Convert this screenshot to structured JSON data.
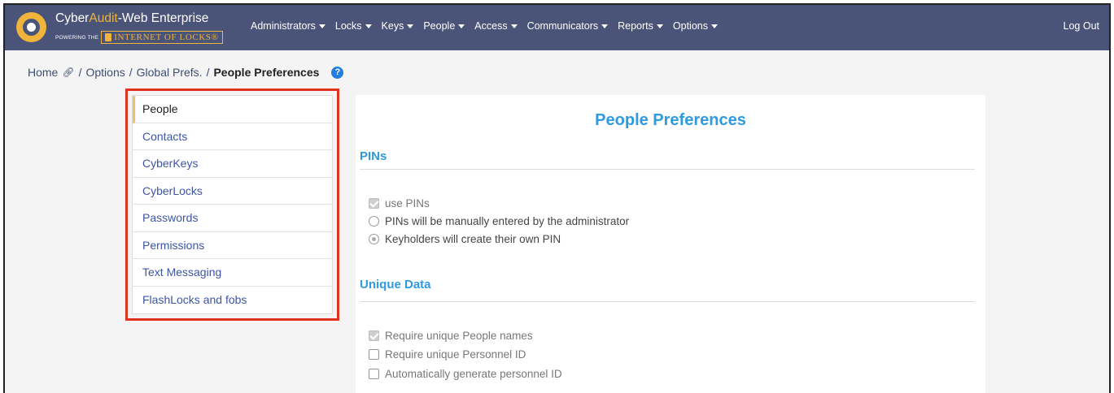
{
  "brand": {
    "name_part1": "Cyber",
    "name_part2": "Audit",
    "name_part3": "-Web Enterprise",
    "tagline_small": "POWERING THE",
    "tagline_big": "INTERNET OF LOCKS®"
  },
  "nav": {
    "items": [
      {
        "label": "Administrators"
      },
      {
        "label": "Locks"
      },
      {
        "label": "Keys"
      },
      {
        "label": "People"
      },
      {
        "label": "Access"
      },
      {
        "label": "Communicators"
      },
      {
        "label": "Reports"
      },
      {
        "label": "Options"
      }
    ],
    "logout": "Log Out"
  },
  "breadcrumb": {
    "home": "Home",
    "sep": "/",
    "options": "Options",
    "global_prefs": "Global Prefs.",
    "current": "People Preferences"
  },
  "sidemenu": {
    "items": [
      {
        "label": "People",
        "active": true
      },
      {
        "label": "Contacts"
      },
      {
        "label": "CyberKeys"
      },
      {
        "label": "CyberLocks"
      },
      {
        "label": "Passwords"
      },
      {
        "label": "Permissions"
      },
      {
        "label": "Text Messaging"
      },
      {
        "label": "FlashLocks and fobs"
      }
    ]
  },
  "panel": {
    "title": "People Preferences",
    "pins": {
      "title": "PINs",
      "use_pins": {
        "label": "use PINs",
        "checked": true
      },
      "manual": {
        "label": "PINs will be manually entered by the administrator",
        "checked": false
      },
      "own": {
        "label": "Keyholders will create their own PIN",
        "checked": true
      }
    },
    "unique": {
      "title": "Unique Data",
      "names": {
        "label": "Require unique People names",
        "checked": true
      },
      "personnel_id": {
        "label": "Require unique Personnel ID",
        "checked": false
      },
      "auto_id": {
        "label": "Automatically generate personnel ID",
        "checked": false
      }
    }
  },
  "colors": {
    "navbar": "#4a5478",
    "accent": "#2e9ae0",
    "highlight_border": "#e0321f",
    "brand_gold": "#f0b33c"
  }
}
